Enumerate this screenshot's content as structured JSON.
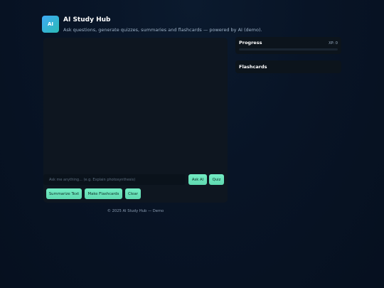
{
  "app": {
    "logo_text": "AI",
    "title": "AI Study Hub",
    "subtitle": "Ask questions, generate quizzes, summaries and flashcards — powered by AI (demo)."
  },
  "chat": {
    "input_placeholder": "Ask me anything... (e.g. Explain photosynthesis)",
    "input_value": "",
    "ask_label": "Ask AI",
    "quiz_label": "Quiz",
    "summarize_label": "Summarize Text",
    "flashcards_label": "Make Flashcards",
    "clear_label": "Clear"
  },
  "sidebar": {
    "progress": {
      "title": "Progress",
      "xp_text": "XP: 0",
      "fraction": 0
    },
    "flashcards": {
      "title": "Flashcards"
    }
  },
  "footer": {
    "text": "© 2025 AI Study Hub — Demo"
  },
  "colors": {
    "accent": "#6ee7c0",
    "logo_gradient_start": "#3fa9f5",
    "logo_gradient_end": "#2bbbb5",
    "background": "#071222",
    "panel": "#0e1620"
  }
}
